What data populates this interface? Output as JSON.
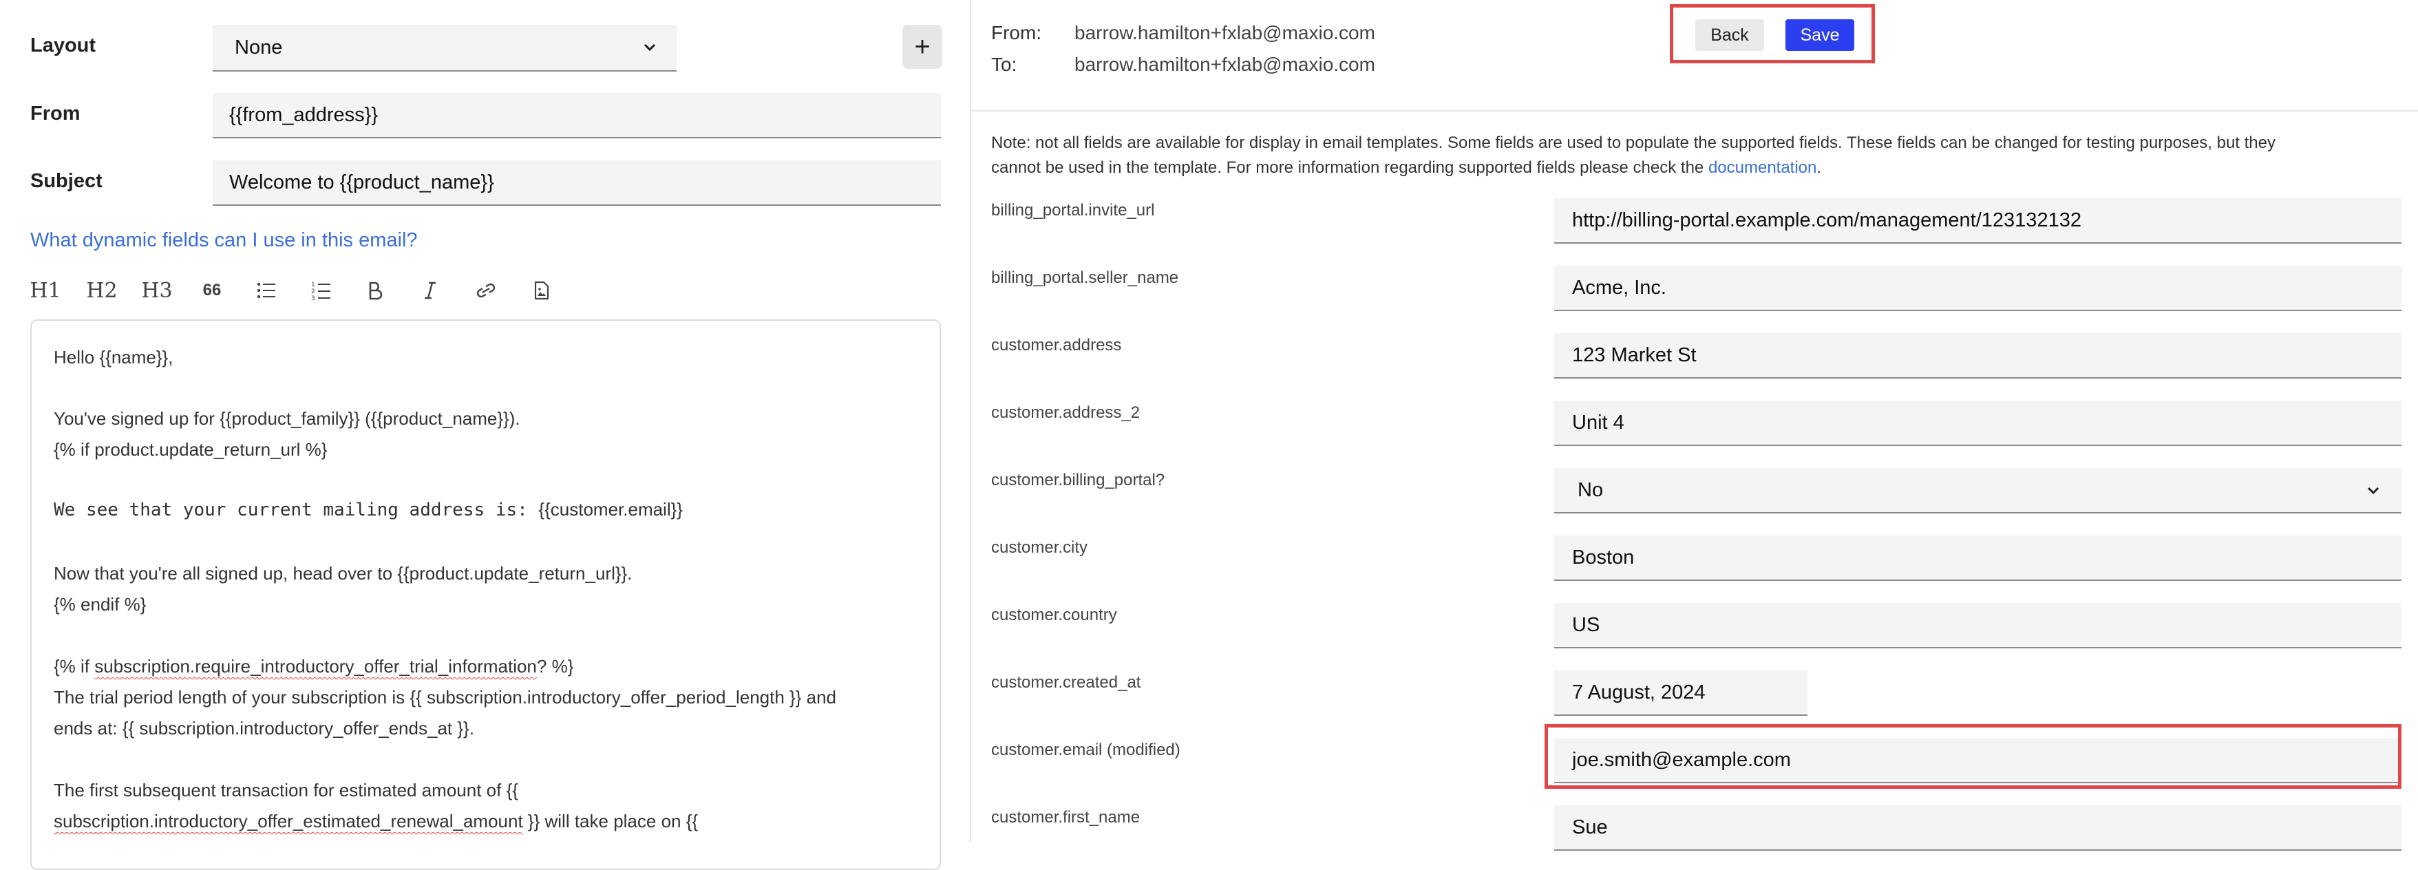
{
  "left": {
    "layout_label": "Layout",
    "layout_value": "None",
    "add_label": "+",
    "from_label": "From",
    "from_value": "{{from_address}}",
    "subject_label": "Subject",
    "subject_value": "Welcome to {{product_name}}",
    "help_link": "What dynamic fields can I use in this email?",
    "toolbar": {
      "h1": "H1",
      "h2": "H2",
      "h3": "H3",
      "quote": "66"
    },
    "editor_lines": [
      "Hello {{name}},",
      "You've signed up for {{product_family}} ({{product_name}}).",
      "{% if product.update_return_url %}",
      "We see that your current mailing address is: ",
      "{{customer.email}}",
      "Now that you're all signed up, head over to {{product.update_return_url}}.",
      "{% endif %}",
      "{% if ",
      "subscription.require_introductory_offer_trial_information",
      "? %}",
      "The trial period length  of your subscription is {{ subscription.introductory_offer_period_length }} and",
      "ends at: {{ subscription.introductory_offer_ends_at }}.",
      "The first subsequent transaction for estimated amount of {{",
      "subscription.introductory_offer_estimated_renewal_amount",
      " }} will take place on {{"
    ]
  },
  "right": {
    "from_key": "From:",
    "from_val": "barrow.hamilton+fxlab@maxio.com",
    "to_key": "To:",
    "to_val": "barrow.hamilton+fxlab@maxio.com",
    "back_label": "Back",
    "save_label": "Save",
    "note_line1": "Note: not all fields are available for display in email templates. Some fields are used to populate the supported fields. These fields can be changed for testing purposes, but they",
    "note_line2_pre": "cannot be used in the template. For more information regarding supported fields please check the ",
    "note_link": "documentation",
    "note_line2_post": ".",
    "fields": [
      {
        "label": "billing_portal.invite_url",
        "value": "http://billing-portal.example.com/management/123132132"
      },
      {
        "label": "billing_portal.seller_name",
        "value": "Acme, Inc."
      },
      {
        "label": "customer.address",
        "value": "123 Market St"
      },
      {
        "label": "customer.address_2",
        "value": "Unit 4"
      },
      {
        "label": "customer.billing_portal?",
        "value": "No"
      },
      {
        "label": "customer.city",
        "value": "Boston"
      },
      {
        "label": "customer.country",
        "value": "US"
      },
      {
        "label": "customer.created_at",
        "value": "7 August, 2024"
      },
      {
        "label": "customer.email (modified)",
        "value": "joe.smith@example.com"
      },
      {
        "label": "customer.first_name",
        "value": "Sue"
      }
    ]
  },
  "colors": {
    "accent_blue": "#2b3ef0",
    "link_blue": "#3b6fd6",
    "highlight_red": "#e04848"
  }
}
